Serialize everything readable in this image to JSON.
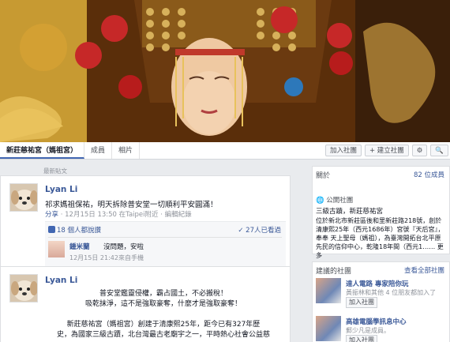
{
  "tabs": [
    {
      "label": "新莊慈祐宮（媽祖宮）"
    },
    {
      "label": "成員"
    },
    {
      "label": "相片"
    }
  ],
  "toolbar": {
    "join": "加入社團",
    "create": "+ 建立社團",
    "settings_icon": "gear-icon",
    "search_icon": "search-icon"
  },
  "feed": {
    "heading": "最新貼文",
    "post1": {
      "author": "Lyan Li",
      "text": "祁求媽祖保祐，明天拆除普安堂一切順利平安圓滿！",
      "meta_share": "分享",
      "meta_time": "· 12月15日 13:50 在Taipei附近 · 編輯紀錄",
      "likes": "18 個人都說讚",
      "shares": "27人已看過",
      "comment": {
        "name": "鍾米蘭",
        "text": "沒問題，安啦",
        "time": "12月15日 21:42來自手機"
      }
    },
    "post2": {
      "author": "Lyan Li",
      "line1": "普安堂鑑靈侵權，霸占國土，不必搬稅！",
      "line2": "吸乾抹淨，這不是強取豪奪，什麼才是強取豪奪！",
      "line3": "新莊慈祐宮（媽祖宮）創建于清康熙25年，距今已有327年歷",
      "line4": "史，為國家三級古蹟，北台灣最古老廟宇之一，平時熱心社會公益慈"
    }
  },
  "right": {
    "about_title": "關於",
    "member_count": "82 位成員",
    "section": "公開社團",
    "relic": "三級古蹟，新莊慈祐宮",
    "desc": "位於新北市新莊區後和里新莊路218號，創於清康熙25年（西元1686年）宮號『天后宮』，奉奉 天上聖母（媽祖），為臺灣開拓台北平原先民的信仰中心，乾隆18年間（西元1…… 更多",
    "sugg_title": "建議的社團",
    "sugg_all": "查看全部社團",
    "items": [
      {
        "name": "達人電路 專家陪你玩",
        "desc": "黃振林和其他 4 位朋友都加入了",
        "btn": "加入社團"
      },
      {
        "name": "高雄電腦學訊息中心",
        "desc": "郵少凡是成員。",
        "btn": "加入社團"
      }
    ]
  }
}
